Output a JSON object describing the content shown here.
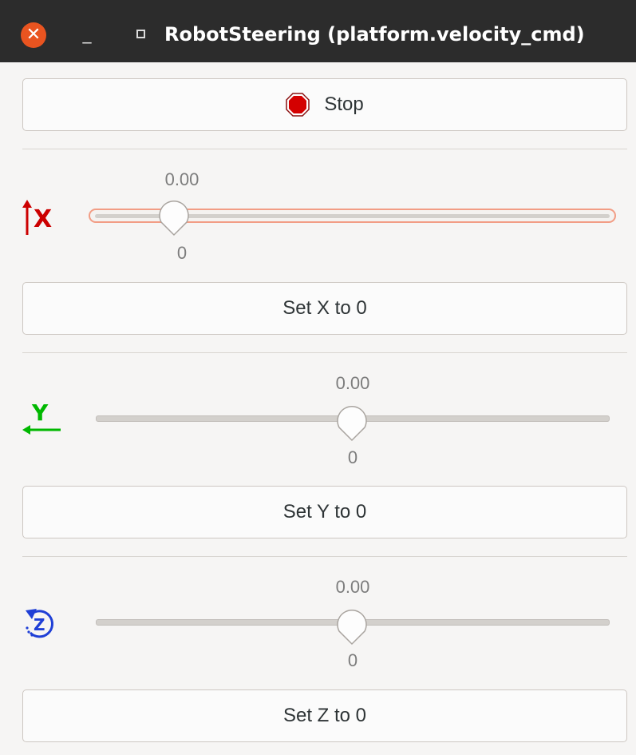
{
  "window": {
    "title": "RobotSteering (platform.velocity_cmd)",
    "close_glyph": "✕",
    "minimize_glyph": "_"
  },
  "stop": {
    "label": "Stop",
    "icon": "stop-sign-icon"
  },
  "x": {
    "axis_label": "X",
    "value": "0.00",
    "tick": "0",
    "reset_label": "Set X to 0",
    "color": "#cc0000",
    "icon": "arrow-up-x-icon",
    "level": 0.16
  },
  "y": {
    "axis_label": "Y",
    "value": "0.00",
    "tick": "0",
    "reset_label": "Set Y to 0",
    "color": "#00b800",
    "icon": "arrow-left-y-icon",
    "level": 0.5
  },
  "z": {
    "axis_label": "Z",
    "value": "0.00",
    "tick": "0",
    "reset_label": "Set Z to 0",
    "color": "#1f3fd6",
    "icon": "rotate-z-icon",
    "level": 0.5
  },
  "colors": {
    "titlebar": "#2c2c2c",
    "close": "#e95420",
    "focus": "#f29d85"
  }
}
